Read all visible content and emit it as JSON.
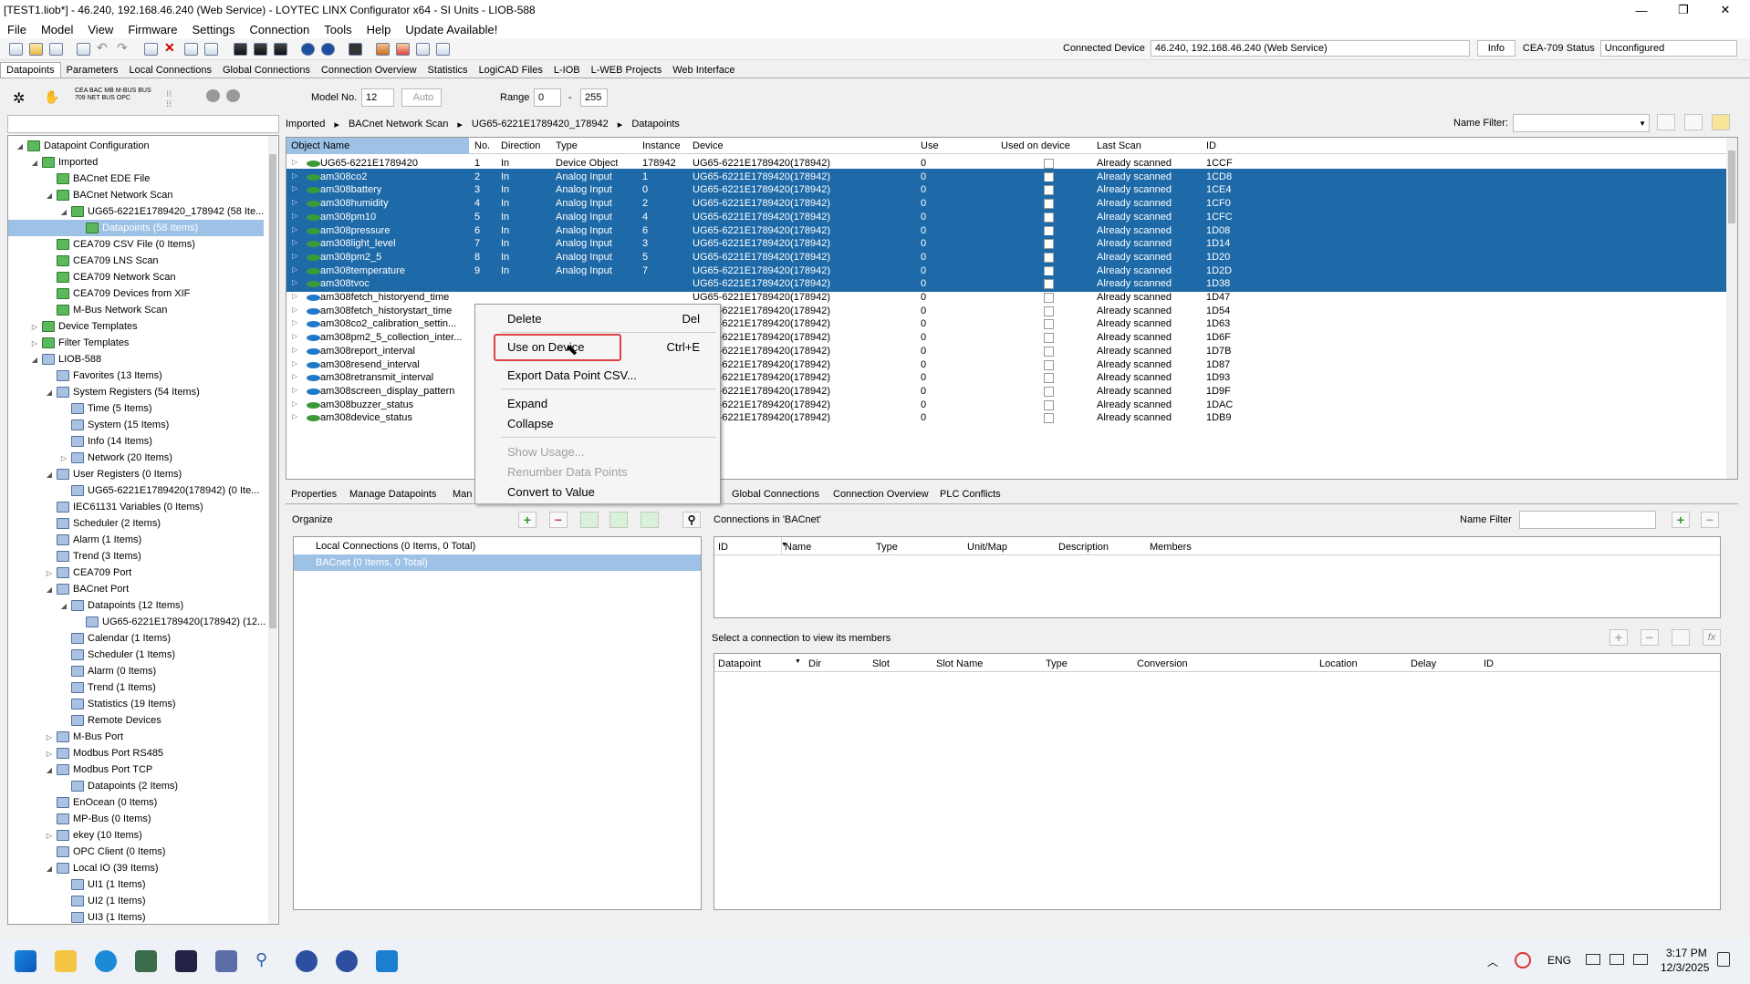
{
  "window": {
    "title": "[TEST1.liob*] - 46.240, 192.168.46.240 (Web Service) - LOYTEC LINX Configurator x64 - SI Units - LIOB-588",
    "minimize": "—",
    "maximize": "❐",
    "close": "✕"
  },
  "menu": [
    "File",
    "Model",
    "View",
    "Firmware",
    "Settings",
    "Connection",
    "Tools",
    "Help",
    "Update Available!"
  ],
  "toolbar": {
    "connected_label": "Connected Device",
    "connected_value": "46.240, 192.168.46.240 (Web Service)",
    "info_label": "Info",
    "cea_label": "CEA-709 Status",
    "cea_value": "Unconfigured"
  },
  "tabs": [
    "Datapoints",
    "Parameters",
    "Local Connections",
    "Global Connections",
    "Connection Overview",
    "Statistics",
    "LogiCAD Files",
    "L-IOB",
    "L-WEB Projects",
    "Web Interface"
  ],
  "toolbar2": {
    "model_label": "Model No.",
    "model_value": "12",
    "auto_label": "Auto",
    "range_label": "Range",
    "range_from": "0",
    "range_dash": "-",
    "range_to": "255",
    "name_filter_label": "Name Filter:"
  },
  "breadcrumb": [
    "Imported",
    "BACnet Network Scan",
    "UG65-6221E1789420_178942",
    "Datapoints"
  ],
  "tree": [
    {
      "label": "Datapoint Configuration",
      "level": 0,
      "toggle": "◢",
      "icon": "g"
    },
    {
      "label": "Imported",
      "level": 1,
      "toggle": "◢",
      "icon": "g"
    },
    {
      "label": "BACnet EDE File",
      "level": 2,
      "toggle": "",
      "icon": "g"
    },
    {
      "label": "BACnet Network Scan",
      "level": 2,
      "toggle": "◢",
      "icon": "g"
    },
    {
      "label": "UG65-6221E1789420_178942 (58 Ite...",
      "level": 3,
      "toggle": "◢",
      "icon": "g"
    },
    {
      "label": "Datapoints (58 Items)",
      "level": 4,
      "toggle": "",
      "icon": "g",
      "selected": true
    },
    {
      "label": "CEA709 CSV File (0 Items)",
      "level": 2,
      "toggle": "",
      "icon": "g"
    },
    {
      "label": "CEA709 LNS Scan",
      "level": 2,
      "toggle": "",
      "icon": "g"
    },
    {
      "label": "CEA709 Network Scan",
      "level": 2,
      "toggle": "",
      "icon": "g"
    },
    {
      "label": "CEA709 Devices from XIF",
      "level": 2,
      "toggle": "",
      "icon": "g"
    },
    {
      "label": "M-Bus Network Scan",
      "level": 2,
      "toggle": "",
      "icon": "g"
    },
    {
      "label": "Device Templates",
      "level": 1,
      "toggle": "▷",
      "icon": "g"
    },
    {
      "label": "Filter Templates",
      "level": 1,
      "toggle": "▷",
      "icon": "g"
    },
    {
      "label": "LIOB-588",
      "level": 1,
      "toggle": "◢",
      "icon": "b"
    },
    {
      "label": "Favorites (13 Items)",
      "level": 2,
      "toggle": "",
      "icon": "b"
    },
    {
      "label": "System Registers (54 Items)",
      "level": 2,
      "toggle": "◢",
      "icon": "b"
    },
    {
      "label": "Time (5 Items)",
      "level": 3,
      "toggle": "",
      "icon": "b"
    },
    {
      "label": "System (15 Items)",
      "level": 3,
      "toggle": "",
      "icon": "b"
    },
    {
      "label": "Info (14 Items)",
      "level": 3,
      "toggle": "",
      "icon": "b"
    },
    {
      "label": "Network (20 Items)",
      "level": 3,
      "toggle": "▷",
      "icon": "b"
    },
    {
      "label": "User Registers (0 Items)",
      "level": 2,
      "toggle": "◢",
      "icon": "b"
    },
    {
      "label": "UG65-6221E1789420(178942) (0 Ite...",
      "level": 3,
      "toggle": "",
      "icon": "b"
    },
    {
      "label": "IEC61131 Variables (0 Items)",
      "level": 2,
      "toggle": "",
      "icon": "b"
    },
    {
      "label": "Scheduler (2 Items)",
      "level": 2,
      "toggle": "",
      "icon": "b"
    },
    {
      "label": "Alarm (1 Items)",
      "level": 2,
      "toggle": "",
      "icon": "b"
    },
    {
      "label": "Trend (3 Items)",
      "level": 2,
      "toggle": "",
      "icon": "b"
    },
    {
      "label": "CEA709 Port",
      "level": 2,
      "toggle": "▷",
      "icon": "b"
    },
    {
      "label": "BACnet Port",
      "level": 2,
      "toggle": "◢",
      "icon": "b"
    },
    {
      "label": "Datapoints (12 Items)",
      "level": 3,
      "toggle": "◢",
      "icon": "b"
    },
    {
      "label": "UG65-6221E1789420(178942) (12...",
      "level": 4,
      "toggle": "",
      "icon": "b"
    },
    {
      "label": "Calendar (1 Items)",
      "level": 3,
      "toggle": "",
      "icon": "b"
    },
    {
      "label": "Scheduler (1 Items)",
      "level": 3,
      "toggle": "",
      "icon": "b"
    },
    {
      "label": "Alarm (0 Items)",
      "level": 3,
      "toggle": "",
      "icon": "b"
    },
    {
      "label": "Trend (1 Items)",
      "level": 3,
      "toggle": "",
      "icon": "b"
    },
    {
      "label": "Statistics (19 Items)",
      "level": 3,
      "toggle": "",
      "icon": "b"
    },
    {
      "label": "Remote Devices",
      "level": 3,
      "toggle": "",
      "icon": "b"
    },
    {
      "label": "M-Bus Port",
      "level": 2,
      "toggle": "▷",
      "icon": "b"
    },
    {
      "label": "Modbus Port RS485",
      "level": 2,
      "toggle": "▷",
      "icon": "b"
    },
    {
      "label": "Modbus Port TCP",
      "level": 2,
      "toggle": "◢",
      "icon": "b"
    },
    {
      "label": "Datapoints (2 Items)",
      "level": 3,
      "toggle": "",
      "icon": "b"
    },
    {
      "label": "EnOcean (0 Items)",
      "level": 2,
      "toggle": "",
      "icon": "b"
    },
    {
      "label": "MP-Bus (0 Items)",
      "level": 2,
      "toggle": "",
      "icon": "b"
    },
    {
      "label": "ekey (10 Items)",
      "level": 2,
      "toggle": "▷",
      "icon": "b"
    },
    {
      "label": "OPC Client (0 Items)",
      "level": 2,
      "toggle": "",
      "icon": "b"
    },
    {
      "label": "Local IO (39 Items)",
      "level": 2,
      "toggle": "◢",
      "icon": "b"
    },
    {
      "label": "UI1 (1 Items)",
      "level": 3,
      "toggle": "",
      "icon": "b"
    },
    {
      "label": "UI2 (1 Items)",
      "level": 3,
      "toggle": "",
      "icon": "b"
    },
    {
      "label": "UI3 (1 Items)",
      "level": 3,
      "toggle": "",
      "icon": "b"
    }
  ],
  "grid": {
    "headers": [
      "Object Name",
      "No.",
      "Direction",
      "Type",
      "Instance",
      "Device",
      "Use",
      "Used on device",
      "Last Scan",
      "ID"
    ],
    "rows": [
      {
        "name": "UG65-6221E1789420",
        "no": "1",
        "dir": "In",
        "type": "Device Object",
        "inst": "178942",
        "dev": "UG65-6221E1789420(178942)",
        "use": "0",
        "scan": "Already scanned",
        "id": "1CCF",
        "sel": false,
        "dot": "#3a9a3a",
        "checked": false
      },
      {
        "name": "am308co2",
        "no": "2",
        "dir": "In",
        "type": "Analog Input",
        "inst": "1",
        "dev": "UG65-6221E1789420(178942)",
        "use": "0",
        "scan": "Already scanned",
        "id": "1CD8",
        "sel": true,
        "dot": "#3a9a3a",
        "checked": false
      },
      {
        "name": "am308battery",
        "no": "3",
        "dir": "In",
        "type": "Analog Input",
        "inst": "0",
        "dev": "UG65-6221E1789420(178942)",
        "use": "0",
        "scan": "Already scanned",
        "id": "1CE4",
        "sel": true,
        "dot": "#3a9a3a",
        "checked": false
      },
      {
        "name": "am308humidity",
        "no": "4",
        "dir": "In",
        "type": "Analog Input",
        "inst": "2",
        "dev": "UG65-6221E1789420(178942)",
        "use": "0",
        "scan": "Already scanned",
        "id": "1CF0",
        "sel": true,
        "dot": "#3a9a3a",
        "checked": false
      },
      {
        "name": "am308pm10",
        "no": "5",
        "dir": "In",
        "type": "Analog Input",
        "inst": "4",
        "dev": "UG65-6221E1789420(178942)",
        "use": "0",
        "scan": "Already scanned",
        "id": "1CFC",
        "sel": true,
        "dot": "#3a9a3a",
        "checked": false
      },
      {
        "name": "am308pressure",
        "no": "6",
        "dir": "In",
        "type": "Analog Input",
        "inst": "6",
        "dev": "UG65-6221E1789420(178942)",
        "use": "0",
        "scan": "Already scanned",
        "id": "1D08",
        "sel": true,
        "dot": "#3a9a3a",
        "checked": false
      },
      {
        "name": "am308light_level",
        "no": "7",
        "dir": "In",
        "type": "Analog Input",
        "inst": "3",
        "dev": "UG65-6221E1789420(178942)",
        "use": "0",
        "scan": "Already scanned",
        "id": "1D14",
        "sel": true,
        "dot": "#3a9a3a",
        "checked": false
      },
      {
        "name": "am308pm2_5",
        "no": "8",
        "dir": "In",
        "type": "Analog Input",
        "inst": "5",
        "dev": "UG65-6221E1789420(178942)",
        "use": "0",
        "scan": "Already scanned",
        "id": "1D20",
        "sel": true,
        "dot": "#3a9a3a",
        "checked": false
      },
      {
        "name": "am308temperature",
        "no": "9",
        "dir": "In",
        "type": "Analog Input",
        "inst": "7",
        "dev": "UG65-6221E1789420(178942)",
        "use": "0",
        "scan": "Already scanned",
        "id": "1D2D",
        "sel": true,
        "dot": "#3a9a3a",
        "checked": false
      },
      {
        "name": "am308tvoc",
        "no": "",
        "dir": "",
        "type": "",
        "inst": "",
        "dev": "UG65-6221E1789420(178942)",
        "use": "0",
        "scan": "Already scanned",
        "id": "1D38",
        "sel": true,
        "dot": "#3a9a3a",
        "checked": false
      },
      {
        "name": "am308fetch_historyend_time",
        "no": "",
        "dir": "",
        "type": "",
        "inst": "",
        "dev": "UG65-6221E1789420(178942)",
        "use": "0",
        "scan": "Already scanned",
        "id": "1D47",
        "sel": false,
        "dot": "#1f78c8",
        "checked": false
      },
      {
        "name": "am308fetch_historystart_time",
        "no": "",
        "dir": "",
        "type": "",
        "inst": "",
        "dev": "UG65-6221E1789420(178942)",
        "use": "0",
        "scan": "Already scanned",
        "id": "1D54",
        "sel": false,
        "dot": "#1f78c8",
        "checked": false
      },
      {
        "name": "am308co2_calibration_settin...",
        "no": "",
        "dir": "",
        "type": "",
        "inst": "",
        "dev": "UG65-6221E1789420(178942)",
        "use": "0",
        "scan": "Already scanned",
        "id": "1D63",
        "sel": false,
        "dot": "#1f78c8",
        "checked": false
      },
      {
        "name": "am308pm2_5_collection_inter...",
        "no": "",
        "dir": "",
        "type": "",
        "inst": "",
        "dev": "UG65-6221E1789420(178942)",
        "use": "0",
        "scan": "Already scanned",
        "id": "1D6F",
        "sel": false,
        "dot": "#1f78c8",
        "checked": false
      },
      {
        "name": "am308report_interval",
        "no": "",
        "dir": "",
        "type": "",
        "inst": "",
        "dev": "UG65-6221E1789420(178942)",
        "use": "0",
        "scan": "Already scanned",
        "id": "1D7B",
        "sel": false,
        "dot": "#1f78c8",
        "checked": false
      },
      {
        "name": "am308resend_interval",
        "no": "",
        "dir": "",
        "type": "",
        "inst": "",
        "dev": "UG65-6221E1789420(178942)",
        "use": "0",
        "scan": "Already scanned",
        "id": "1D87",
        "sel": false,
        "dot": "#1f78c8",
        "checked": false
      },
      {
        "name": "am308retransmit_interval",
        "no": "",
        "dir": "",
        "type": "",
        "inst": "",
        "dev": "UG65-6221E1789420(178942)",
        "use": "0",
        "scan": "Already scanned",
        "id": "1D93",
        "sel": false,
        "dot": "#1f78c8",
        "checked": false
      },
      {
        "name": "am308screen_display_pattern",
        "no": "",
        "dir": "",
        "type": "",
        "inst": "",
        "dev": "UG65-6221E1789420(178942)",
        "use": "0",
        "scan": "Already scanned",
        "id": "1D9F",
        "sel": false,
        "dot": "#1f78c8",
        "checked": false
      },
      {
        "name": "am308buzzer_status",
        "no": "",
        "dir": "",
        "type": "",
        "inst": "",
        "dev": "UG65-6221E1789420(178942)",
        "use": "0",
        "scan": "Already scanned",
        "id": "1DAC",
        "sel": false,
        "dot": "#3a9a3a",
        "checked": false
      },
      {
        "name": "am308device_status",
        "no": "",
        "dir": "",
        "type": "",
        "inst": "",
        "dev": "UG65-6221E1789420(178942)",
        "use": "0",
        "scan": "Already scanned",
        "id": "1DB9",
        "sel": false,
        "dot": "#3a9a3a",
        "checked": false
      }
    ]
  },
  "context_menu": {
    "delete": "Delete",
    "delete_sc": "Del",
    "use": "Use on Device",
    "use_sc": "Ctrl+E",
    "export": "Export Data Point CSV...",
    "expand": "Expand",
    "collapse": "Collapse",
    "show_usage": "Show Usage...",
    "renumber": "Renumber Data Points",
    "convert": "Convert to Value"
  },
  "bottom_tabs": [
    "Properties",
    "Manage Datapoints",
    "Man",
    "Global Connections",
    "Connection Overview",
    "PLC Conflicts"
  ],
  "organize": {
    "label": "Organize",
    "items": [
      "Local Connections (0 Items, 0 Total)",
      "BACnet (0 Items, 0 Total)"
    ]
  },
  "connections": {
    "title": "Connections in 'BACnet'",
    "name_filter": "Name Filter",
    "headers": [
      "ID",
      "Name",
      "Type",
      "Unit/Map",
      "Description",
      "Members"
    ],
    "members_label": "Select a connection to view its members",
    "member_headers": [
      "Datapoint",
      "Dir",
      "Slot",
      "Slot Name",
      "Type",
      "Conversion",
      "Location",
      "Delay",
      "ID"
    ],
    "fx": "fx"
  },
  "taskbar": {
    "lang": "ENG",
    "time": "3:17 PM",
    "date": "12/3/2025",
    "chevron": "︿"
  }
}
